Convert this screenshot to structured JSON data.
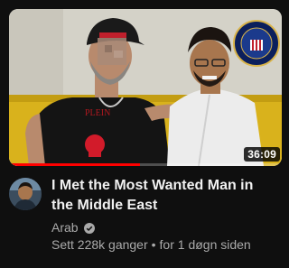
{
  "video": {
    "duration": "36:09",
    "watched_fraction": 0.48,
    "title_line1": "I Met the Most Wanted Man in",
    "title_line2": "the Middle East",
    "channel_name": "Arab",
    "views": "Sett 228k ganger",
    "separator": "•",
    "age": "for 1 døgn siden",
    "verified_icon": "verified-check-icon"
  },
  "colors": {
    "background": "#0f0f0f",
    "title": "#f1f1f1",
    "meta": "#aaaaaa",
    "progress": "#ff0000"
  }
}
